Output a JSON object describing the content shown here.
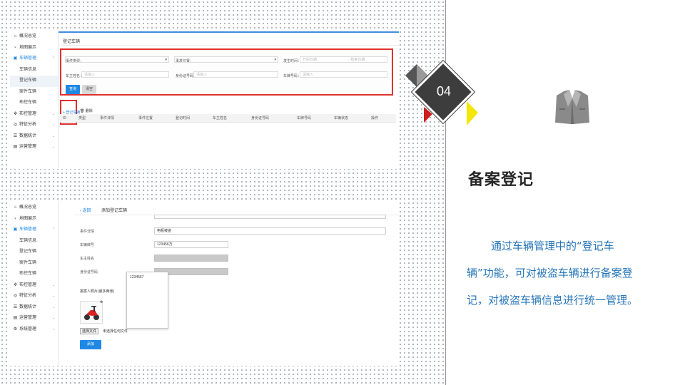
{
  "slide": {
    "number": "04",
    "heading": "备案登记",
    "description": "通过车辆管理中的“登记车辆”功能，可对被盗车辆进行备案登记，对被盗车辆信息进行统一管理。"
  },
  "colors": {
    "accent_blue": "#1e88e5",
    "highlight_red": "#e03030",
    "diamond_dark": "#3d3d3d",
    "triangle_red": "#cc1f1f",
    "triangle_yellow": "#f2e60b",
    "text_blue": "#2475b8"
  },
  "icons": {
    "suit": "suit-jacket-icon"
  },
  "screenshot1": {
    "sidebar": [
      {
        "icon": "home-icon",
        "glyph": "⌂",
        "label": "概况总览",
        "type": "top"
      },
      {
        "icon": "map-pin-icon",
        "glyph": "♀",
        "label": "地图展示",
        "type": "top"
      },
      {
        "icon": "car-icon",
        "glyph": "▣",
        "label": "车辆管理",
        "type": "top-active"
      },
      {
        "icon": "",
        "glyph": "",
        "label": "车辆信息",
        "type": "sub"
      },
      {
        "icon": "",
        "glyph": "",
        "label": "登记车辆",
        "type": "sub-selected"
      },
      {
        "icon": "",
        "glyph": "",
        "label": "案件车辆",
        "type": "sub"
      },
      {
        "icon": "",
        "glyph": "",
        "label": "布控车辆",
        "type": "sub"
      },
      {
        "icon": "control-icon",
        "glyph": "✲",
        "label": "布控管理",
        "type": "top"
      },
      {
        "icon": "analysis-icon",
        "glyph": "◎",
        "label": "特征分析",
        "type": "top"
      },
      {
        "icon": "stats-icon",
        "glyph": "☰",
        "label": "数据统计",
        "type": "top"
      },
      {
        "icon": "ops-icon",
        "glyph": "▤",
        "label": "运营管理",
        "type": "top"
      }
    ],
    "title": "登记车辆",
    "filters": {
      "event_type_label": "事件类型：",
      "event_location_label": "事发位置：",
      "event_time_label": "发生时间：",
      "start_date_placeholder": "开始日期",
      "end_date_placeholder": "→ 结束日期",
      "owner_name_label": "车主姓名：",
      "owner_name_placeholder": "请输入",
      "id_number_label": "身份证号码：",
      "id_number_placeholder": "请输入",
      "plate_label": "车牌号码：",
      "plate_placeholder": "请输入",
      "query_button": "查询",
      "clear_button": "清空"
    },
    "actions": {
      "add": "+ 登记车辆",
      "delete": "🗑 删除"
    },
    "table_headers": [
      "ID",
      "类型",
      "事件详情",
      "事件位置",
      "登记时间",
      "车主姓名",
      "身份证号码",
      "车牌号码",
      "车辆状态",
      "操作"
    ]
  },
  "screenshot2": {
    "sidebar": [
      {
        "icon": "home-icon",
        "glyph": "⌂",
        "label": "概况总览",
        "type": "top"
      },
      {
        "icon": "map-pin-icon",
        "glyph": "♀",
        "label": "地图展示",
        "type": "top"
      },
      {
        "icon": "car-icon",
        "glyph": "▣",
        "label": "车辆管理",
        "type": "top-active"
      },
      {
        "icon": "",
        "glyph": "",
        "label": "车辆信息",
        "type": "sub"
      },
      {
        "icon": "",
        "glyph": "",
        "label": "登记车辆",
        "type": "sub"
      },
      {
        "icon": "",
        "glyph": "",
        "label": "案件车辆",
        "type": "sub"
      },
      {
        "icon": "",
        "glyph": "",
        "label": "布控车辆",
        "type": "sub"
      },
      {
        "icon": "control-icon",
        "glyph": "✲",
        "label": "布控管理",
        "type": "top"
      },
      {
        "icon": "analysis-icon",
        "glyph": "◎",
        "label": "特征分析",
        "type": "top"
      },
      {
        "icon": "stats-icon",
        "glyph": "☰",
        "label": "数据统计",
        "type": "top"
      },
      {
        "icon": "ops-icon",
        "glyph": "▤",
        "label": "运营管理",
        "type": "top"
      },
      {
        "icon": "system-icon",
        "glyph": "⚙",
        "label": "系统管理",
        "type": "top"
      }
    ],
    "back": "‹ 返回",
    "title": "添加登记车辆",
    "form": {
      "event_detail_label": "事件详情",
      "event_detail_value": "电瓶被盗",
      "plate_label": "车辆牌号",
      "plate_value": "123456万",
      "owner_label": "车主姓名",
      "id_label": "身份证号码",
      "suggestion": "1234567",
      "photo_label": "报案人照片(最多两张)",
      "photo_remove": "⊗",
      "choose_file": "选择文件",
      "no_file": "未选择任何文件",
      "submit": "添加"
    }
  }
}
